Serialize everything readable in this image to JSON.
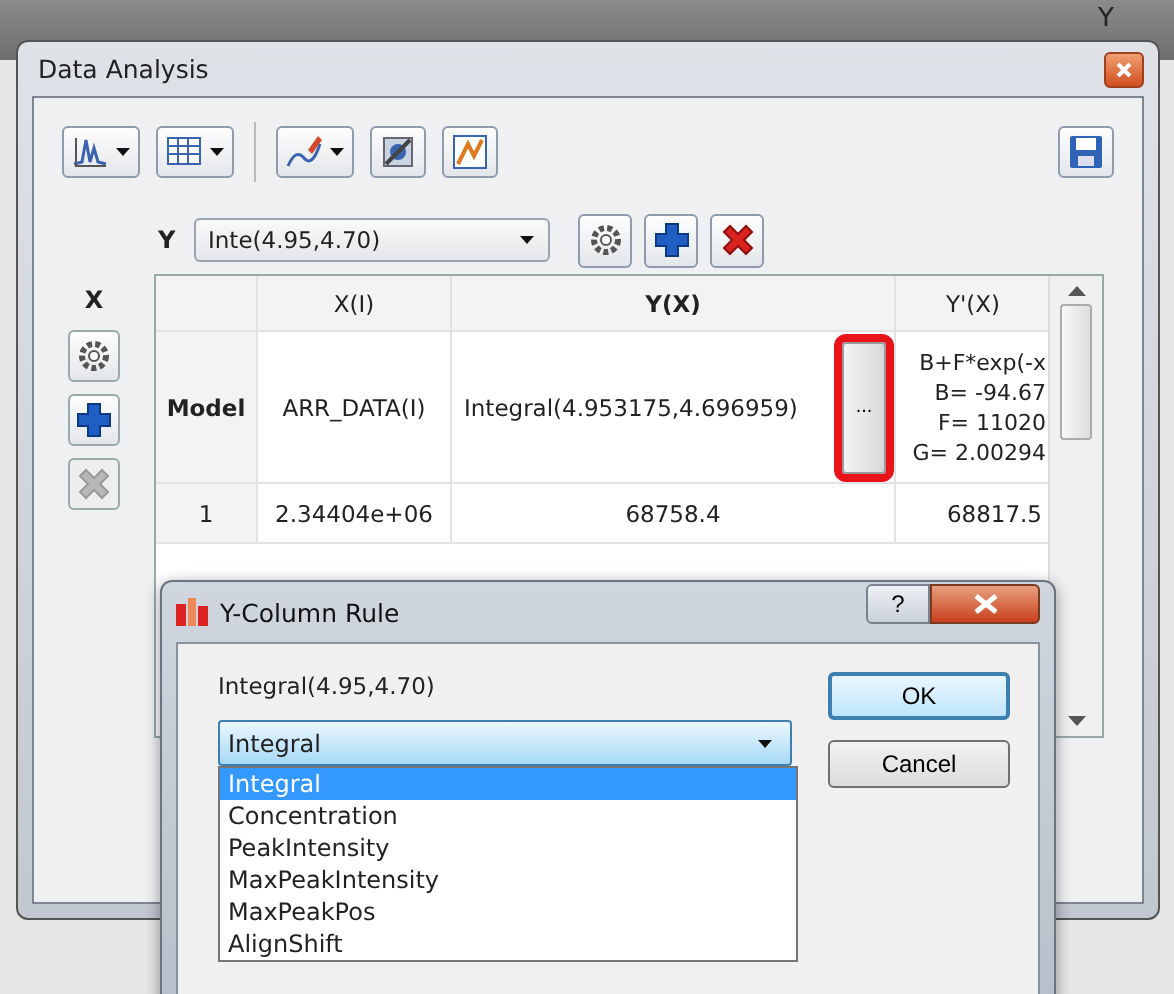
{
  "background_window": {
    "text": "Y"
  },
  "window": {
    "title": "Data Analysis"
  },
  "y_selector": {
    "label": "Y",
    "value": "Inte(4.95,4.70)"
  },
  "x_panel": {
    "label": "X",
    "delete_disabled": true
  },
  "table": {
    "columns": [
      "X(I)",
      "Y(X)",
      "Y'(X)"
    ],
    "model_row": {
      "header": "Model",
      "x_cell": "ARR_DATA(I)",
      "y_cell": "Integral(4.953175,4.696959)",
      "edit_button": "...",
      "edit_highlighted": true,
      "y_prime_lines": [
        "B+F*exp(-x",
        "B= -94.67",
        "F= 11020",
        "G= 2.00294"
      ]
    },
    "rows": [
      {
        "header": "1",
        "cells": [
          "2.34404e+06",
          "68758.4",
          "68817.5"
        ]
      }
    ]
  },
  "dialog": {
    "title": "Y-Column Rule",
    "help": "?",
    "group_label": "Integral(4.95,4.70)",
    "combo": {
      "value": "Integral",
      "expanded": true
    },
    "options": [
      {
        "label": "Integral",
        "selected": true
      },
      {
        "label": "Concentration",
        "selected": false
      },
      {
        "label": "PeakIntensity",
        "selected": false
      },
      {
        "label": "MaxPeakIntensity",
        "selected": false
      },
      {
        "label": "MaxPeakPos",
        "selected": false
      },
      {
        "label": "AlignShift",
        "selected": false
      }
    ],
    "buttons": [
      {
        "label": "OK",
        "default": true
      },
      {
        "label": "Cancel",
        "default": false
      }
    ]
  }
}
